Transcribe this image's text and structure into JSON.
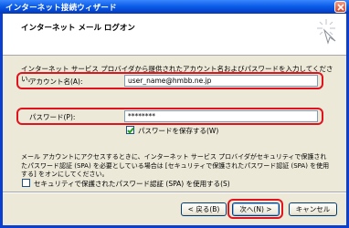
{
  "window": {
    "title": "インターネット接続ウィザード"
  },
  "header": {
    "title": "インターネット メール ログオン"
  },
  "intro": "インターネット サービス プロバイダから提供されたアカウント名およびパスワードを入力してください。",
  "account": {
    "label": "アカウント名(A):",
    "value": "user_name@hmbb.ne.jp"
  },
  "password": {
    "label": "パスワード(P):",
    "value": "********",
    "remember_label": "パスワードを保存する(W)",
    "remember_checked": true
  },
  "description": "メール アカウントにアクセスするときに、インターネット サービス プロバイダがセキュリティで保護されたパスワード認証 (SPA) を必要としている場合は [セキュリティで保護されたパスワード認証 (SPA) を使用する] をオンにしてください。",
  "spa": {
    "label": "セキュリティで保護されたパスワード認証 (SPA) を使用する(S)",
    "checked": false
  },
  "buttons": {
    "back": "< 戻る(B)",
    "next": "次へ(N) >",
    "cancel": "キャンセル"
  },
  "colors": {
    "highlight": "#e0141e",
    "titlebar": "#0b5ee8",
    "client": "#ece9d8"
  }
}
